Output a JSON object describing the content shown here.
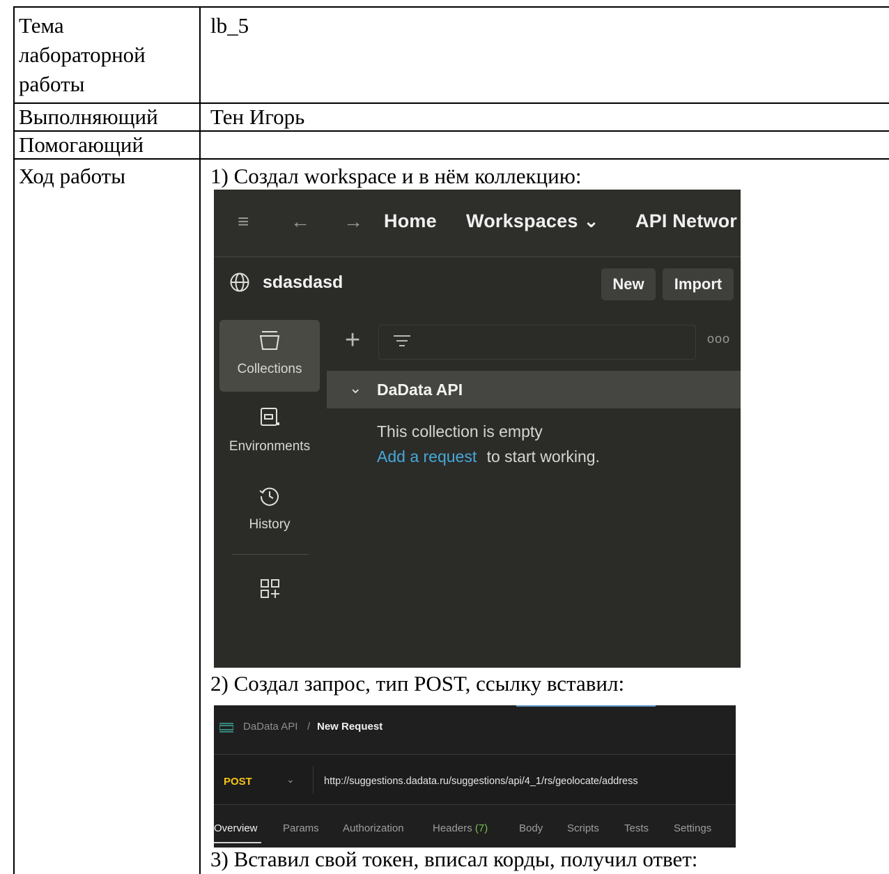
{
  "doc": {
    "topic_label": [
      "Тема",
      "лабораторной",
      "работы"
    ],
    "topic_value": "lb_5",
    "executor_label": "Выполняющий",
    "executor_value": "Тен Игорь",
    "helper_label": "Помогающий",
    "helper_value": "",
    "progress_label": "Ход работы",
    "steps": [
      "1) Создал workspace и в нём коллекцию:",
      "2)  Создал запрос, тип POST, ссылку вставил:",
      "3) Вставил свой токен, вписал корды, получил ответ:"
    ]
  },
  "shot1": {
    "top_nav": {
      "home": "Home",
      "workspaces": "Workspaces ⌄",
      "api_network": "API Networ"
    },
    "workspace_name": "sdasdasd",
    "buttons": {
      "new": "New",
      "import": "Import"
    },
    "sidebar": [
      {
        "label": "Collections",
        "icon": "collections-icon",
        "active": true
      },
      {
        "label": "Environments",
        "icon": "environments-icon",
        "active": false
      },
      {
        "label": "History",
        "icon": "history-icon",
        "active": false
      }
    ],
    "more_icon": "ooo",
    "collection": {
      "name": "DaData API",
      "empty_text": "This collection is empty",
      "add_link": "Add a request",
      "add_suffix": "to start working."
    }
  },
  "shot2": {
    "breadcrumb": {
      "collection": "DaData API",
      "separator": "/",
      "request": "New Request"
    },
    "method": "POST",
    "url": "http://suggestions.dadata.ru/suggestions/api/4_1/rs/geolocate/address",
    "tabs": [
      {
        "label": "Overview",
        "active": true
      },
      {
        "label": "Params"
      },
      {
        "label": "Authorization"
      },
      {
        "label": "Headers",
        "count": "(7)"
      },
      {
        "label": "Body"
      },
      {
        "label": "Scripts"
      },
      {
        "label": "Tests"
      },
      {
        "label": "Settings"
      }
    ],
    "colors": {
      "method": "#f5c518",
      "count": "#74c24a",
      "link": "#46a8d8"
    }
  }
}
